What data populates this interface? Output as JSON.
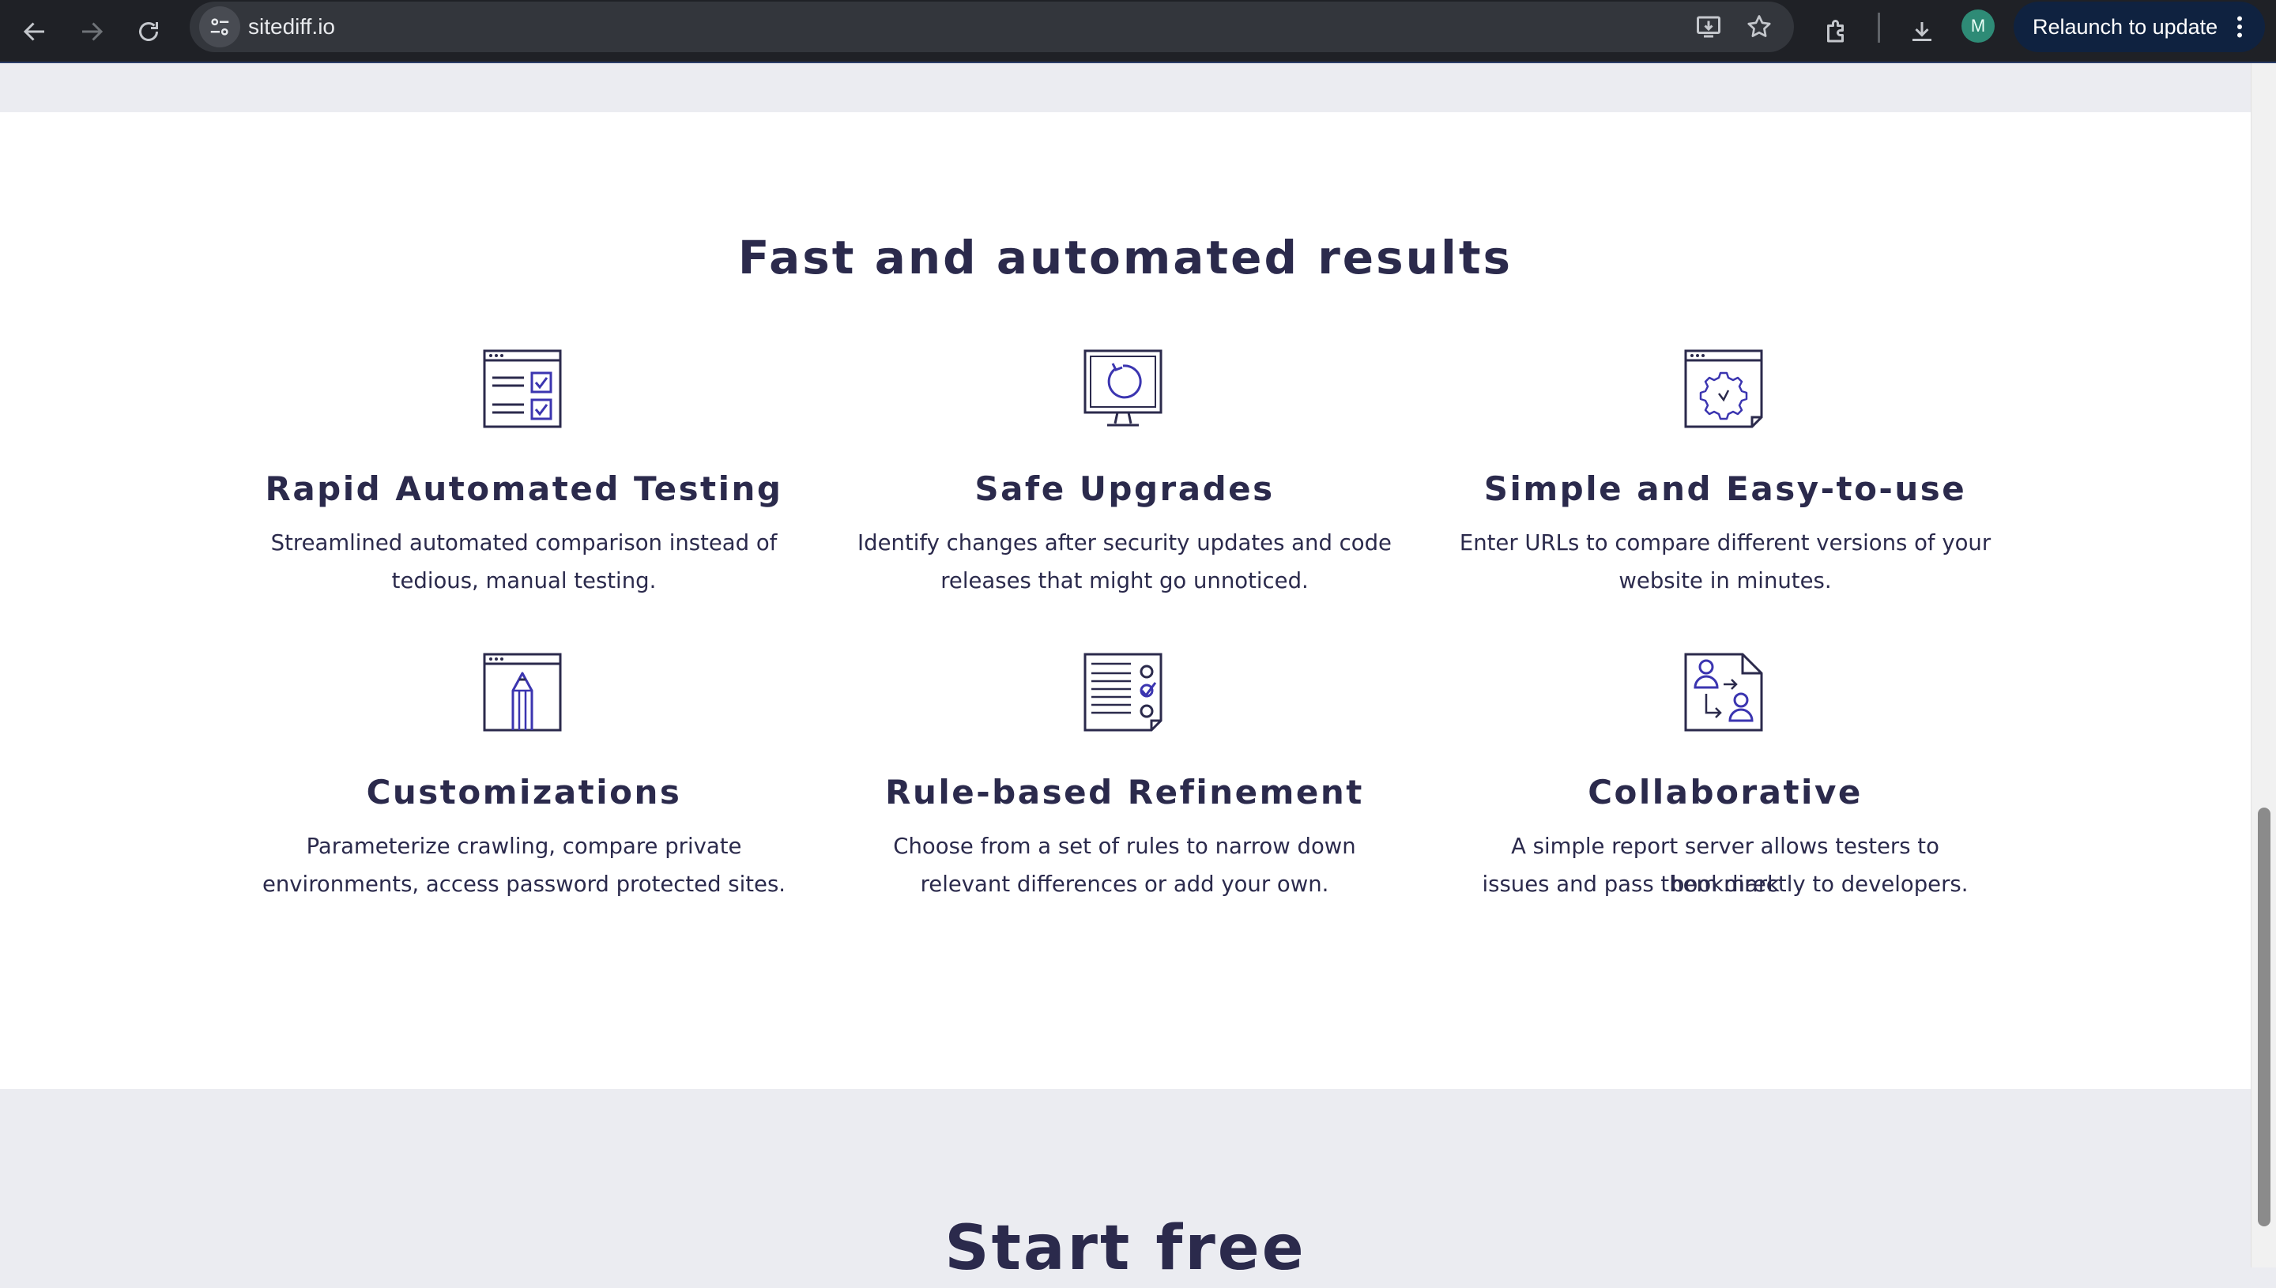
{
  "browser": {
    "url": "sitediff.io",
    "avatar_letter": "M",
    "relaunch_label": "Relaunch to update",
    "icons": [
      "back-icon",
      "forward-icon",
      "reload-icon",
      "site-info-icon",
      "install-app-icon",
      "bookmark-star-icon",
      "extensions-icon",
      "downloads-icon",
      "more-vert-icon"
    ]
  },
  "features": {
    "title": "Fast and automated results",
    "items": [
      {
        "title": "Rapid Automated Testing",
        "line1": "Streamlined automated comparison instead of",
        "line2": "tedious, manual testing."
      },
      {
        "title": "Safe Upgrades",
        "line1": "Identify changes after security updates and code",
        "line2": "releases that might go unnoticed."
      },
      {
        "title": "Simple and Easy-to-use",
        "line1": "Enter URLs to compare different versions of your",
        "line2": "website in minutes."
      },
      {
        "title": "Customizations",
        "line1": "Parameterize crawling, compare private",
        "line2": "environments, access password protected sites."
      },
      {
        "title": "Rule-based Refinement",
        "line1": "Choose from a set of rules to narrow down",
        "line2": "relevant differences or add your own."
      },
      {
        "title": "Collaborative",
        "line1": "A simple report server allows testers to bookmark",
        "line2": "issues and pass them directly to developers."
      }
    ]
  },
  "next_section": {
    "title": "Start free"
  },
  "colors": {
    "heading": "#2b2a4c",
    "accent": "#3b35b0",
    "band": "#ebecf1"
  }
}
